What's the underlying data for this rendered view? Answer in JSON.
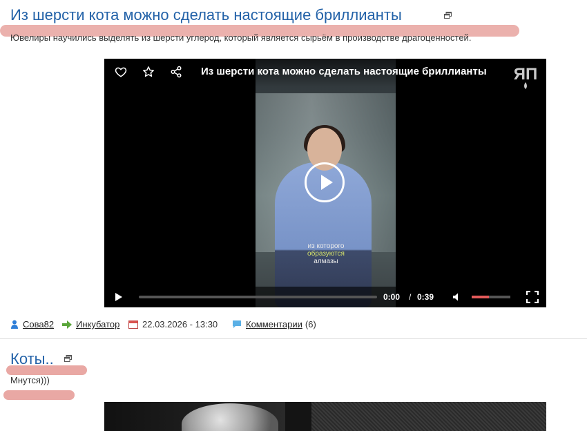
{
  "post1": {
    "title": "Из шерсти кота можно сделать настоящие бриллианты",
    "description": "Ювелиры научились выделять из шерсти углерод, который является сырьём в производстве драгоценностей.",
    "video": {
      "title": "Из шерсти кота можно сделать настоящие бриллианты",
      "logo": "ЯП",
      "subtitle_line1": "из которого",
      "subtitle_line2": "образуются",
      "subtitle_line3": "алмазы",
      "current_time": "0:00",
      "separator": "/",
      "total_time": "0:39",
      "progress": 0,
      "volume": 0.45,
      "volume_color": "#e35a5a"
    },
    "meta": {
      "author": "Сова82",
      "category": "Инкубатор",
      "date": "22.03.2026 - 13:30",
      "comments_label": "Комментарии",
      "comments_count": "(6)"
    }
  },
  "post2": {
    "title": "Коты..",
    "description": "Мнутся)))"
  },
  "colors": {
    "title_link": "#2362a8",
    "highlight": "#e9a8a4"
  }
}
